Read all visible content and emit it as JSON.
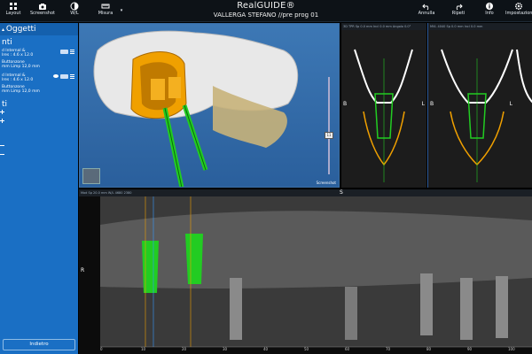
{
  "toolbar": {
    "items": [
      "Layout",
      "Screenshot",
      "W/L",
      "Misura"
    ],
    "right_items": [
      "Annulla",
      "Ripeti",
      "Info",
      "Impostazioni"
    ]
  },
  "app": {
    "brand": "RealGUIDE®",
    "patient": "VALLERGA STEFANO  //pre prog 01"
  },
  "sidebar": {
    "title": "Oggetti",
    "section1": "nti",
    "impl1": [
      "d Internal &",
      "Ires : 4.6 x 12.0",
      "",
      "Buttonzone",
      "mm Limp 12,0 mm"
    ],
    "impl2": [
      "d Internal &",
      "Ires : 4.6 x 12.0",
      "",
      "Buttonzone",
      "mm Limp 12,0 mm"
    ],
    "section2": "ti",
    "back_label": "Indietro"
  },
  "views": {
    "v3d_label": "Screenshot",
    "slider_value": "11",
    "slice_side_left": "B",
    "slice_side_right": "L",
    "slice_side_b2": "B",
    "slice_side_l2": "L",
    "pano_top": "S",
    "pano_left": "R",
    "pano_ticks": [
      "0",
      "10",
      "20",
      "30",
      "40",
      "50",
      "60",
      "70",
      "80",
      "90",
      "100"
    ],
    "mid_header": "3D  TPR    Sp 0.0 mm   Incl 0.0 mm   Angolo 0.0°",
    "right_header": "MVL 4040   Sp 0.0 mm  Incl 0.0 mm",
    "pano_header": "Mod    Sp 20.0 mm   W/L 4680 2380"
  },
  "colors": {
    "accent": "#1a6fc4",
    "guide": "#f0a000",
    "implant": "#22cc22",
    "bone": "#e6e6e6"
  }
}
